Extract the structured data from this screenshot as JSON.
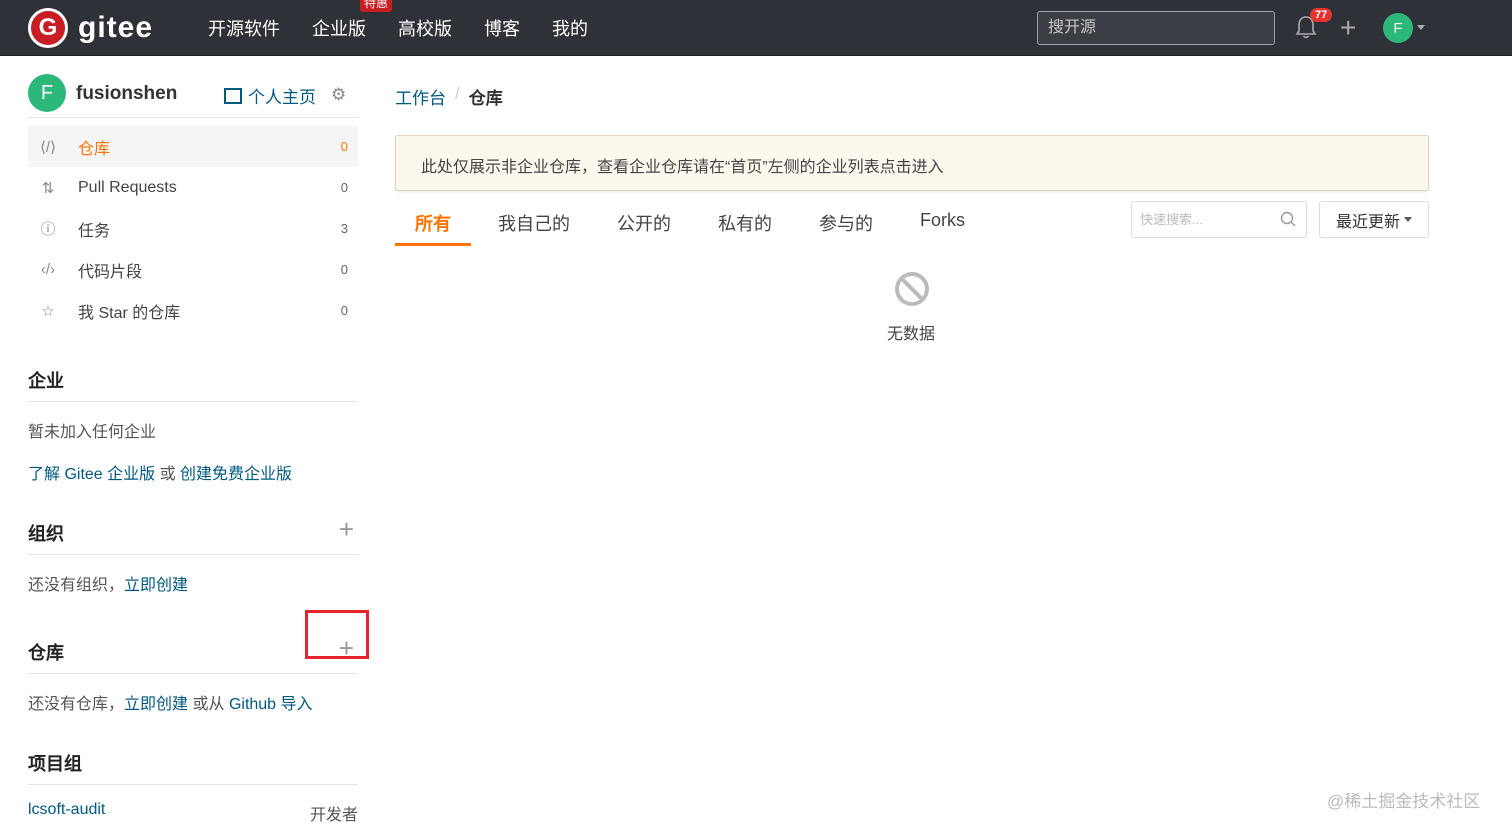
{
  "brand": {
    "name": "gitee",
    "logo_letter": "G",
    "color": "#c71d23"
  },
  "nav": {
    "items": [
      {
        "label": "开源软件"
      },
      {
        "label": "企业版",
        "badge": "特惠"
      },
      {
        "label": "高校版"
      },
      {
        "label": "博客"
      },
      {
        "label": "我的"
      }
    ],
    "search_placeholder": "搜开源",
    "notification_count": "77",
    "avatar_letter": "F"
  },
  "sidebar": {
    "user": {
      "avatar_letter": "F",
      "name": "fusionshen",
      "profile_link": "个人主页"
    },
    "menu": [
      {
        "label": "仓库",
        "count": "0",
        "icon": "code-icon",
        "active": true
      },
      {
        "label": "Pull Requests",
        "count": "0",
        "icon": "pull-request-icon"
      },
      {
        "label": "任务",
        "count": "3",
        "icon": "issue-icon"
      },
      {
        "label": "代码片段",
        "count": "0",
        "icon": "snippet-icon"
      },
      {
        "label": "我 Star 的仓库",
        "count": "0",
        "icon": "star-icon"
      }
    ],
    "enterprise": {
      "title": "企业",
      "empty_text": "暂未加入任何企业",
      "learn_link": "了解 Gitee 企业版",
      "or_text": " 或 ",
      "create_link": "创建免费企业版"
    },
    "orgs": {
      "title": "组织",
      "empty_text": "还没有组织，",
      "create_link": "立即创建"
    },
    "repos": {
      "title": "仓库",
      "empty_text": "还没有仓库，",
      "create_link": "立即创建",
      "or_from_text": " 或从 ",
      "import_link": "Github 导入"
    },
    "project_groups": {
      "title": "项目组",
      "items": [
        {
          "name": "lcsoft-audit",
          "role": "开发者"
        }
      ]
    }
  },
  "main": {
    "breadcrumb": {
      "parent": "工作台",
      "separator": "/",
      "current": "仓库"
    },
    "notice": "此处仅展示非企业仓库，查看企业仓库请在“首页”左侧的企业列表点击进入",
    "tabs": [
      {
        "label": "所有",
        "active": true
      },
      {
        "label": "我自己的"
      },
      {
        "label": "公开的"
      },
      {
        "label": "私有的"
      },
      {
        "label": "参与的"
      },
      {
        "label": "Forks"
      }
    ],
    "quick_search_placeholder": "快速搜索...",
    "sort_label": "最近更新",
    "empty_text": "无数据"
  },
  "watermark": "@稀土掘金技术社区",
  "colors": {
    "accent": "#fe7300",
    "link": "#005980",
    "topbar": "#2e3137",
    "avatar": "#2cb77b",
    "highlight": "#e5242c"
  }
}
